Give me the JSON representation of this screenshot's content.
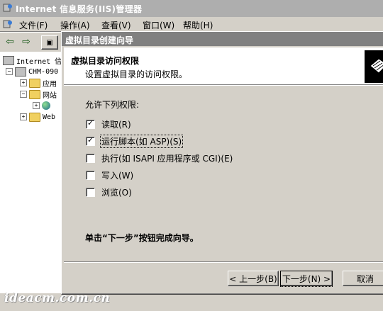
{
  "main_window": {
    "title": "Internet 信息服务(IIS)管理器",
    "menu": [
      "文件(F)",
      "操作(A)",
      "查看(V)",
      "窗口(W)",
      "帮助(H)"
    ],
    "toolbar_icons": [
      "back-arrow-icon",
      "forward-arrow-icon",
      "up-folder-icon"
    ],
    "tree": [
      {
        "label": "Internet 信",
        "level": 0,
        "expander": ""
      },
      {
        "label": "CHM-090",
        "level": 0,
        "expander": "−"
      },
      {
        "label": "应用",
        "level": 1,
        "expander": "+"
      },
      {
        "label": "网站",
        "level": 1,
        "expander": "−"
      },
      {
        "label": "",
        "level": 2,
        "expander": "+"
      },
      {
        "label": "Web",
        "level": 1,
        "expander": "+"
      }
    ],
    "watermark": "ideacm.com.cn"
  },
  "wizard": {
    "title": "虚拟目录创建向导",
    "header_title": "虚拟目录访问权限",
    "header_subtitle": "设置虚拟目录的访问权限。",
    "prompt": "允许下列权限:",
    "permissions": [
      {
        "label": "读取(R)",
        "checked": true
      },
      {
        "label": "运行脚本(如 ASP)(S)",
        "checked": true
      },
      {
        "label": "执行(如 ISAPI 应用程序或 CGI)(E)",
        "checked": false
      },
      {
        "label": "写入(W)",
        "checked": false
      },
      {
        "label": "浏览(O)",
        "checked": false
      }
    ],
    "instruction": "单击“下一步”按钮完成向导。",
    "buttons": {
      "back": "< 上一步(B)",
      "next": "下一步(N) >",
      "cancel": "取消"
    }
  }
}
